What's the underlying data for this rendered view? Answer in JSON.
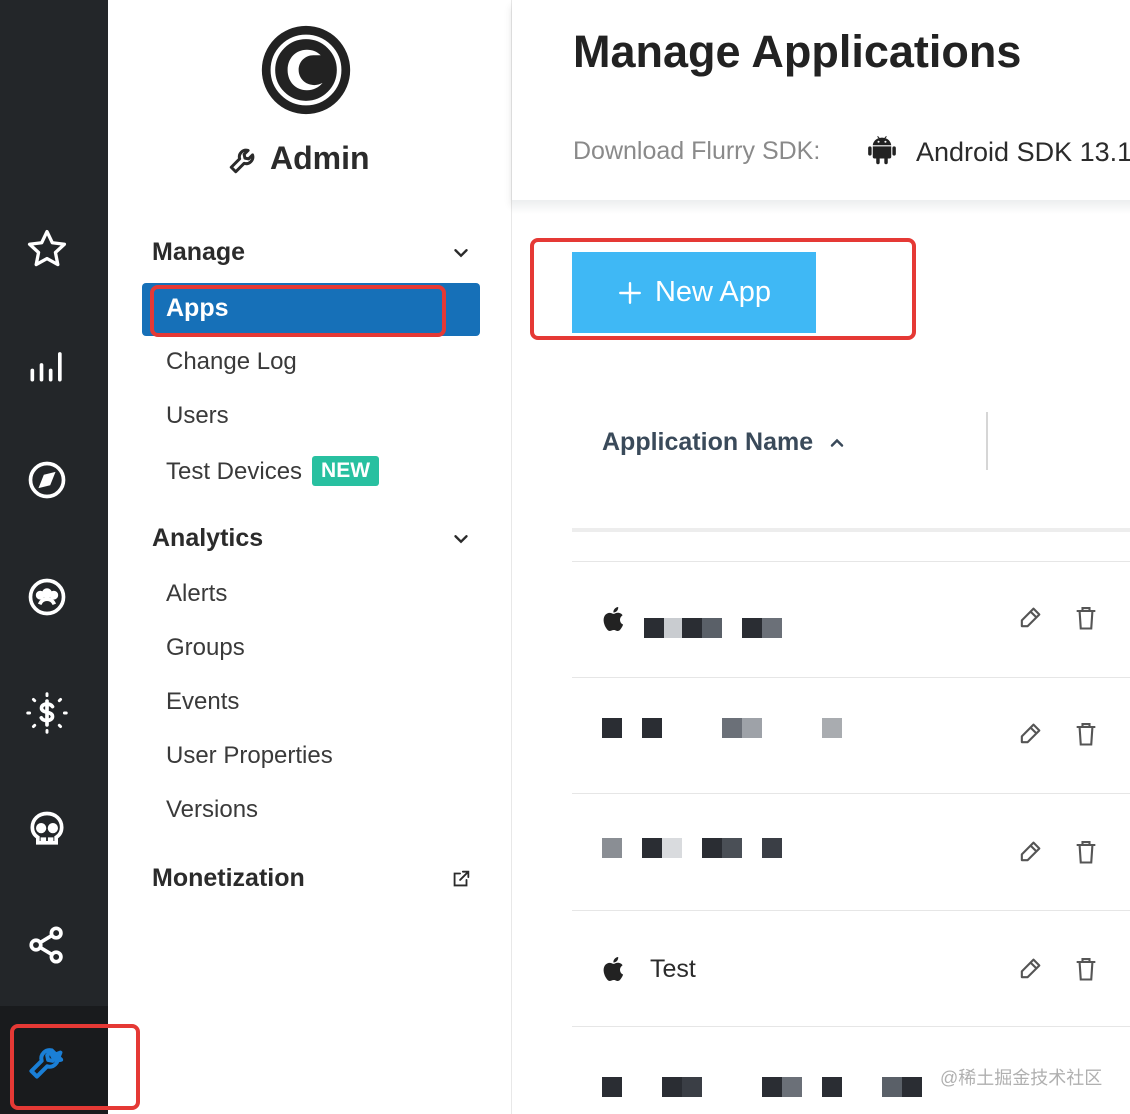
{
  "rail": {
    "items": [
      {
        "icon": "star-icon"
      },
      {
        "icon": "bar-chart-icon"
      },
      {
        "icon": "compass-icon"
      },
      {
        "icon": "users-icon"
      },
      {
        "icon": "revenue-icon"
      },
      {
        "icon": "skull-icon"
      },
      {
        "icon": "share-icon"
      },
      {
        "icon": "wrench-icon",
        "active": true
      }
    ]
  },
  "sidebar": {
    "title": "Admin",
    "sections": [
      {
        "label": "Manage",
        "items": [
          "Apps",
          "Change Log",
          "Users",
          "Test Devices"
        ]
      },
      {
        "label": "Analytics",
        "items": [
          "Alerts",
          "Groups",
          "Events",
          "User Properties",
          "Versions"
        ]
      },
      {
        "label": "Monetization"
      }
    ],
    "new_badge": "NEW"
  },
  "header": {
    "title": "Manage Applications",
    "sdk_label": "Download Flurry SDK:",
    "sdk_link": "Android SDK 13.1"
  },
  "main": {
    "new_app_label": "New App",
    "column_header": "Application Name",
    "rows": [
      {
        "platform": "apple",
        "name": ""
      },
      {
        "platform": "",
        "name": ""
      },
      {
        "platform": "",
        "name": ""
      },
      {
        "platform": "apple",
        "name": "Test"
      },
      {
        "platform": "",
        "name": ""
      }
    ]
  },
  "colors": {
    "rail_bg": "#232629",
    "active_nav": "#1670b8",
    "primary_button": "#3fb8f5",
    "badge": "#28c0a0",
    "active_rail_icon": "#1a7fd6",
    "highlight": "#e53935"
  },
  "watermark": "@稀土掘金技术社区"
}
